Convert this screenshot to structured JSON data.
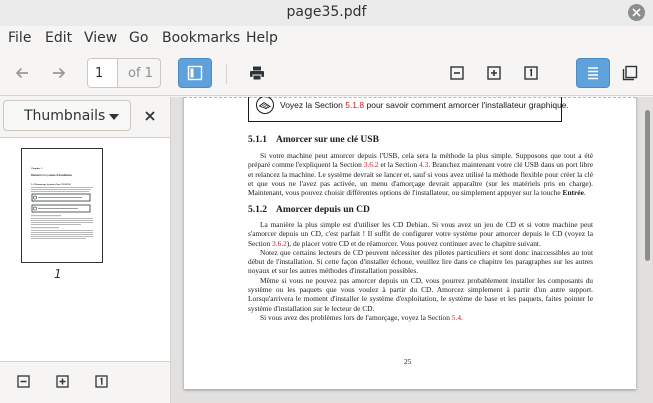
{
  "window": {
    "title": "page35.pdf"
  },
  "menu": [
    "File",
    "Edit",
    "View",
    "Go",
    "Bookmarks",
    "Help"
  ],
  "toolbar": {
    "page_current": "1",
    "page_total": "of 1"
  },
  "sidebar": {
    "mode_label": "Thumbnails",
    "thumbnail_page_label": "1",
    "thumbnail_mini": {
      "chapter": "Chapitre 5",
      "title": "Démarrer le système d'installation",
      "section": "5.1  Démarrage à partir d'un CD-ROM"
    }
  },
  "document": {
    "note_prefix": "Voyez la Section ",
    "note_ref": "5.1.8",
    "note_suffix": " pour savoir comment amorcer l'installateur graphique.",
    "section1_num": "5.1.1",
    "section1_title": "Amorcer sur une clé USB",
    "section1_p1_a": "Si votre machine peut amorcer depuis l'USB, cela sera la méthode la plus simple. Supposons que tout a été préparé comme l'expliquent la Section ",
    "section1_p1_ref1": "3.6.2",
    "section1_p1_b": " et la Section ",
    "section1_p1_ref2": "4.3",
    "section1_p1_c": ". Branchez maintenant votre clé USB dans un port libre et relancez la machine. Le système devrait se lancer et, sauf si vous avez utilisé la méthode flexible pour créer la clé et que vous ne l'avez pas activée, un menu d'amorçage devrait apparaître (sur les matériels pris en charge). Maintenant, vous pouvez choisir différentes options de l'installateur, ou simplement appuyer sur la touche ",
    "section1_p1_key": "Entrée",
    "section1_p1_end": ".",
    "section2_num": "5.1.2",
    "section2_title": "Amorcer depuis un CD",
    "section2_p1_a": "La manière la plus simple est d'utiliser les CD Debian. Si vous avez un jeu de CD et si votre machine peut s'amorcer depuis un CD, c'est parfait ! Il suffit de configurer votre système pour amorcer depuis le CD (voyez la Section ",
    "section2_p1_ref": "3.6.2",
    "section2_p1_b": "), de placer votre CD et de réamorcer. Vous pouvez continuer avec le chapitre suivant.",
    "section2_p2": "Notez que certains lecteurs de CD peuvent nécessiter des pilotes particuliers et sont donc inaccessibles au tout début de l'installation. Si cette façon d'installer échoue, veuillez lire dans ce chapitre les paragraphes sur les autres noyaux et sur les autres méthodes d'installation possibles.",
    "section2_p3": "Même si vous ne pouvez pas amorcer depuis un CD, vous pourrez probablement installer les composants du système ou les paquets que vous voulez à partir du CD. Amorcez simplement à partir d'un autre support. Lorsqu'arrivera le moment d'installer le système d'exploitation, le système de base et les paquets, faites pointer le système d'installation sur le lecteur de CD.",
    "section2_p4_a": "Si vous avez des problèmes lors de l'amorçage, voyez la Section ",
    "section2_p4_ref": "5.4",
    "section2_p4_b": ".",
    "page_number": "25"
  }
}
